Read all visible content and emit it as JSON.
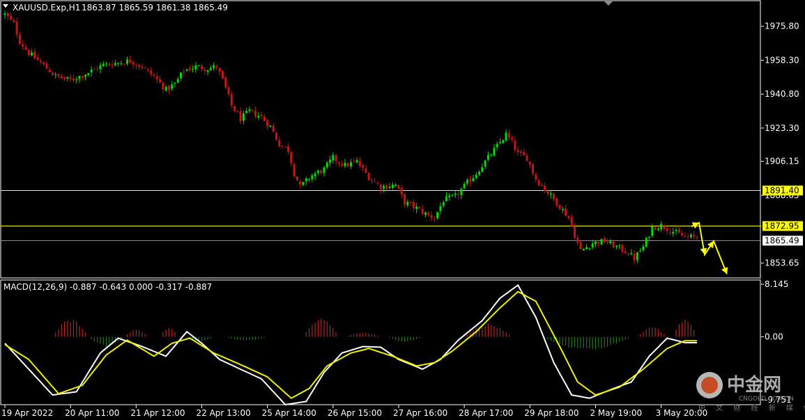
{
  "header": {
    "symbol_text": "XAUUSD.Exp,H1",
    "ohlc_text": "1863.87 1865.59 1861.38 1865.49"
  },
  "macd_header": {
    "text": "MACD(12,26,9) -0.887 -0.643 0.000 -0.317 -0.887"
  },
  "watermark": {
    "brand": "中金网",
    "site": "CNGOLD.COM.CN",
    "subtitle": "中 文 财 经 新 媒 体"
  },
  "colors": {
    "background": "#000000",
    "frame": "#ffffff",
    "bull": "#00dc00",
    "bear": "#c81414",
    "level": "#ffff00",
    "current_price_line": "#8a8a8a",
    "macd_line": "#ffffff",
    "signal_line": "#f0f000",
    "hist_pos": "#b4281e",
    "hist_neg": "#1e7a1e"
  },
  "chart_data": [
    {
      "type": "candlestick",
      "symbol": "XAUUSD.Exp",
      "timeframe": "H1",
      "ylim": [
        1846.0,
        1989.0
      ],
      "y_ticks": [
        "1975.80",
        "1958.30",
        "1940.80",
        "1923.30",
        "1906.15",
        "1888.65",
        "1853.65"
      ],
      "x_ticks": [
        "19 Apr 2022",
        "20 Apr 11:00",
        "21 Apr 12:00",
        "22 Apr 13:00",
        "25 Apr 14:00",
        "26 Apr 15:00",
        "27 Apr 16:00",
        "28 Apr 17:00",
        "29 Apr 18:00",
        "2 May 19:00",
        "3 May 20:00"
      ],
      "levels": [
        {
          "value": 1891.4,
          "label": "1891.40",
          "color": "#ffff00"
        },
        {
          "value": 1872.95,
          "label": "1872.95",
          "color": "#ffff00"
        }
      ],
      "current_price": {
        "value": 1865.49,
        "label": "1865.49"
      },
      "close_path": [
        [
          0,
          1982
        ],
        [
          3,
          1977
        ],
        [
          5,
          1968
        ],
        [
          8,
          1962
        ],
        [
          12,
          1957
        ],
        [
          17,
          1950
        ],
        [
          22,
          1948
        ],
        [
          28,
          1952
        ],
        [
          33,
          1956
        ],
        [
          38,
          1957
        ],
        [
          42,
          1958
        ],
        [
          46,
          1955
        ],
        [
          50,
          1950
        ],
        [
          54,
          1943
        ],
        [
          57,
          1946
        ],
        [
          60,
          1953
        ],
        [
          64,
          1955
        ],
        [
          68,
          1954
        ],
        [
          71,
          1955
        ],
        [
          73,
          1948
        ],
        [
          76,
          1935
        ],
        [
          79,
          1928
        ],
        [
          82,
          1932
        ],
        [
          86,
          1929
        ],
        [
          89,
          1924
        ],
        [
          92,
          1915
        ],
        [
          95,
          1912
        ],
        [
          97,
          1900
        ],
        [
          99,
          1893
        ],
        [
          103,
          1899
        ],
        [
          107,
          1902
        ],
        [
          110,
          1908
        ],
        [
          114,
          1904
        ],
        [
          118,
          1906
        ],
        [
          122,
          1898
        ],
        [
          126,
          1893
        ],
        [
          131,
          1894
        ],
        [
          134,
          1885
        ],
        [
          138,
          1882
        ],
        [
          141,
          1879
        ],
        [
          144,
          1877
        ],
        [
          147,
          1886
        ],
        [
          151,
          1888
        ],
        [
          155,
          1895
        ],
        [
          158,
          1900
        ],
        [
          162,
          1908
        ],
        [
          165,
          1914
        ],
        [
          168,
          1920
        ],
        [
          170,
          1916
        ],
        [
          172,
          1910
        ],
        [
          175,
          1908
        ],
        [
          178,
          1897
        ],
        [
          182,
          1890
        ],
        [
          186,
          1883
        ],
        [
          189,
          1877
        ],
        [
          191,
          1868
        ],
        [
          193,
          1860
        ],
        [
          197,
          1864
        ],
        [
          201,
          1865
        ],
        [
          205,
          1862
        ],
        [
          209,
          1859
        ],
        [
          211,
          1856
        ],
        [
          214,
          1862
        ],
        [
          217,
          1872
        ],
        [
          220,
          1873
        ],
        [
          224,
          1870
        ],
        [
          228,
          1867
        ],
        [
          232,
          1867
        ]
      ],
      "projection_arrows": [
        [
          1892,
          1872.5
        ],
        [
          1897,
          1872.0
        ],
        [
          1903,
          1874.5
        ],
        [
          1908,
          1871.5
        ],
        [
          1911,
          1858.0
        ],
        [
          1924,
          1865.0
        ],
        [
          1934,
          1869.0
        ],
        [
          1943,
          1848.0
        ],
        [
          1942,
          1844.5
        ]
      ]
    },
    {
      "type": "macd",
      "params": "MACD(12,26,9)",
      "values_text": "-0.887 -0.643 0.000 -0.317 -0.887",
      "ylim": [
        -10.5,
        8.8
      ],
      "y_ticks": [
        "8.145",
        "0.00",
        "-9.751"
      ],
      "macd_path": [
        [
          0,
          -1.0
        ],
        [
          8,
          -5.0
        ],
        [
          16,
          -9.0
        ],
        [
          24,
          -8.5
        ],
        [
          32,
          -2.5
        ],
        [
          38,
          -0.2
        ],
        [
          46,
          -1.5
        ],
        [
          54,
          -3.0
        ],
        [
          61,
          0.8
        ],
        [
          66,
          -1.0
        ],
        [
          72,
          -3.5
        ],
        [
          78,
          -4.8
        ],
        [
          86,
          -6.5
        ],
        [
          94,
          -10.5
        ],
        [
          101,
          -10.0
        ],
        [
          107,
          -5.5
        ],
        [
          113,
          -2.5
        ],
        [
          120,
          -1.5
        ],
        [
          126,
          -1.6
        ],
        [
          132,
          -3.5
        ],
        [
          140,
          -5.0
        ],
        [
          146,
          -3.5
        ],
        [
          152,
          -0.5
        ],
        [
          160,
          2.5
        ],
        [
          166,
          6.0
        ],
        [
          172,
          8.0
        ],
        [
          178,
          3.0
        ],
        [
          184,
          -4.0
        ],
        [
          190,
          -9.0
        ],
        [
          196,
          -9.5
        ],
        [
          204,
          -8.0
        ],
        [
          210,
          -7.0
        ],
        [
          216,
          -3.0
        ],
        [
          222,
          -0.2
        ],
        [
          228,
          -0.9
        ],
        [
          232,
          -0.9
        ]
      ],
      "signal_path": [
        [
          0,
          -1.2
        ],
        [
          8,
          -3.5
        ],
        [
          18,
          -8.8
        ],
        [
          26,
          -7.5
        ],
        [
          34,
          -2.8
        ],
        [
          41,
          -0.5
        ],
        [
          50,
          -3.0
        ],
        [
          56,
          -1.0
        ],
        [
          62,
          -0.2
        ],
        [
          70,
          -2.5
        ],
        [
          80,
          -4.5
        ],
        [
          88,
          -6.2
        ],
        [
          96,
          -9.5
        ],
        [
          102,
          -8.0
        ],
        [
          108,
          -4.5
        ],
        [
          116,
          -2.5
        ],
        [
          122,
          -1.8
        ],
        [
          130,
          -3.0
        ],
        [
          138,
          -4.5
        ],
        [
          144,
          -4.0
        ],
        [
          150,
          -2.2
        ],
        [
          158,
          0.8
        ],
        [
          166,
          4.5
        ],
        [
          172,
          7.0
        ],
        [
          178,
          5.5
        ],
        [
          186,
          -1.5
        ],
        [
          192,
          -7.0
        ],
        [
          198,
          -9.0
        ],
        [
          206,
          -7.8
        ],
        [
          214,
          -5.0
        ],
        [
          222,
          -1.8
        ],
        [
          228,
          -0.6
        ],
        [
          232,
          -0.6
        ]
      ],
      "hist_bursts": [
        [
          16,
          28,
          2.8
        ],
        [
          28,
          40,
          -1.5
        ],
        [
          40,
          48,
          1.2
        ],
        [
          52,
          58,
          1.6
        ],
        [
          60,
          70,
          -0.8
        ],
        [
          74,
          88,
          -0.6
        ],
        [
          100,
          112,
          2.9
        ],
        [
          114,
          126,
          0.7
        ],
        [
          128,
          140,
          -0.8
        ],
        [
          154,
          170,
          2.1
        ],
        [
          180,
          210,
          -2.1
        ],
        [
          212,
          222,
          1.6
        ],
        [
          224,
          232,
          3.0
        ]
      ]
    }
  ]
}
